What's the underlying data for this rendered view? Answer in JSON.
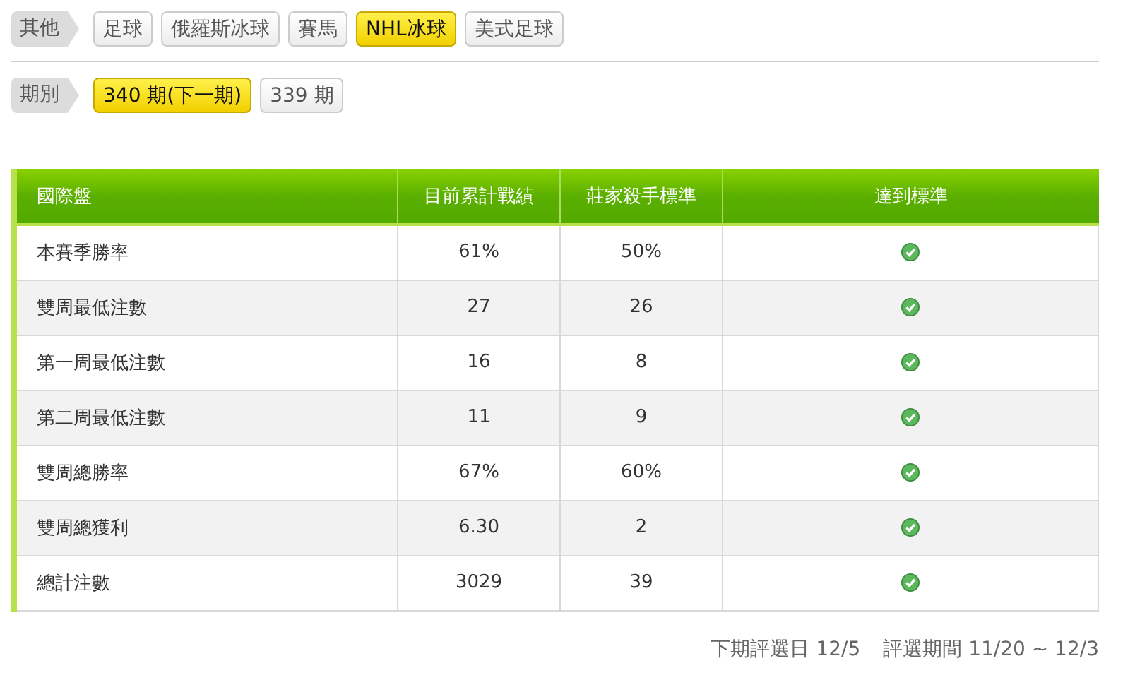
{
  "filters": [
    {
      "label": "其他",
      "items": [
        {
          "label": "足球",
          "selected": false
        },
        {
          "label": "俄羅斯冰球",
          "selected": false
        },
        {
          "label": "賽馬",
          "selected": false
        },
        {
          "label": "NHL冰球",
          "selected": true
        },
        {
          "label": "美式足球",
          "selected": false
        }
      ]
    },
    {
      "label": "期別",
      "items": [
        {
          "label": "340 期(下一期)",
          "selected": true
        },
        {
          "label": "339 期",
          "selected": false
        }
      ]
    }
  ],
  "table": {
    "columns": [
      "國際盤",
      "目前累計戰績",
      "莊家殺手標準",
      "達到標準"
    ],
    "rows": [
      {
        "name": "本賽季勝率",
        "current": "61%",
        "standard": "50%",
        "met": true
      },
      {
        "name": "雙周最低注數",
        "current": "27",
        "standard": "26",
        "met": true
      },
      {
        "name": "第一周最低注數",
        "current": "16",
        "standard": "8",
        "met": true
      },
      {
        "name": "第二周最低注數",
        "current": "11",
        "standard": "9",
        "met": true
      },
      {
        "name": "雙周總勝率",
        "current": "67%",
        "standard": "60%",
        "met": true
      },
      {
        "name": "雙周總獲利",
        "current": "6.30",
        "standard": "2",
        "met": true
      },
      {
        "name": "總計注數",
        "current": "3029",
        "standard": "39",
        "met": true
      }
    ]
  },
  "footer": {
    "next_selection": "下期評選日 12/5",
    "selection_period": "評選期間 11/20 ~ 12/3"
  }
}
